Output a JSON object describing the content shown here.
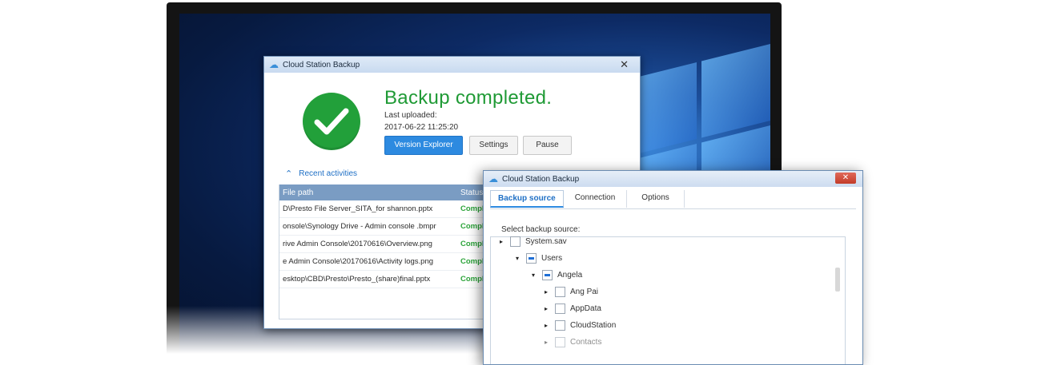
{
  "window1": {
    "title": "Cloud Station Backup",
    "headline": "Backup completed.",
    "last_uploaded_label": "Last uploaded:",
    "last_uploaded_value": "2017-06-22 11:25:20",
    "buttons": {
      "version_explorer": "Version Explorer",
      "settings": "Settings",
      "pause": "Pause"
    },
    "recent_label": "Recent activities",
    "table": {
      "columns": [
        "File path",
        "Status"
      ],
      "rows": [
        {
          "path": "D\\Presto File Server_SITA_for shannon.pptx",
          "status": "Compl"
        },
        {
          "path": "onsole\\Synology Drive - Admin console .bmpr",
          "status": "Compl"
        },
        {
          "path": "rive Admin Console\\20170616\\Overview.png",
          "status": "Compl"
        },
        {
          "path": "e Admin Console\\20170616\\Activity logs.png",
          "status": "Compl"
        },
        {
          "path": "esktop\\CBD\\Presto\\Presto_(share)final.pptx",
          "status": "Compl"
        }
      ]
    }
  },
  "window2": {
    "title": "Cloud Station Backup",
    "tabs": [
      "Backup source",
      "Connection",
      "Options"
    ],
    "active_tab": "Backup source",
    "select_label": "Select backup source:",
    "tree": [
      "System.sav",
      "Users",
      "Angela",
      "Ang Pai",
      "AppData",
      "CloudStation",
      "Contacts"
    ]
  },
  "colors": {
    "accent": "#2d8ae0",
    "success": "#22a03a",
    "close_red": "#c23b29"
  }
}
